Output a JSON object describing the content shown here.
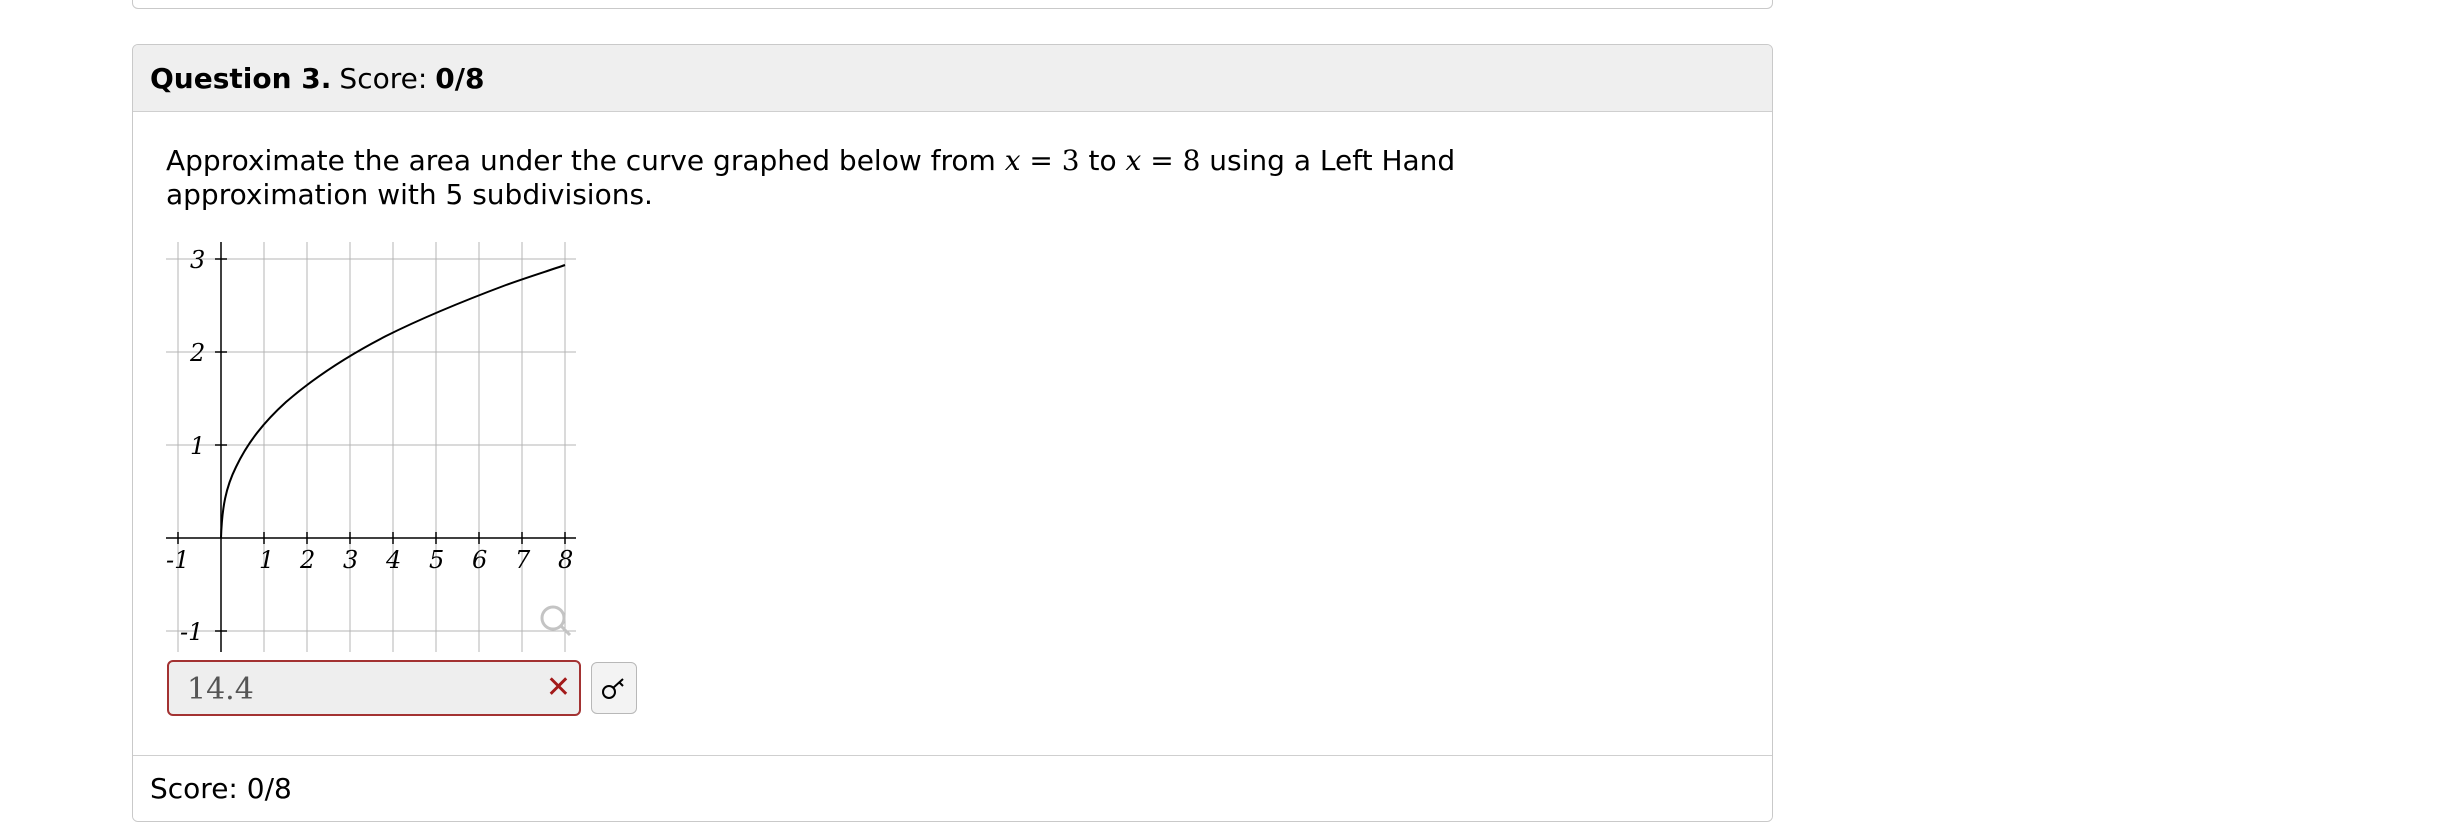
{
  "question": {
    "label": "Question 3.",
    "score_prefix": "Score:",
    "score_value": "0/8"
  },
  "prompt": {
    "part1": "Approximate the area under the curve graphed below from ",
    "x_var": "x",
    "eq": " = ",
    "from_val": "3",
    "to_word": " to ",
    "to_val": "8",
    "part2": " using a Left Hand",
    "line2": "approximation with 5 subdivisions."
  },
  "graph": {
    "x_tick_labels": [
      "-1",
      "1",
      "2",
      "3",
      "4",
      "5",
      "6",
      "7",
      "8"
    ],
    "y_tick_labels": [
      "3",
      "2",
      "1",
      "-1"
    ],
    "curve": "sqrt-like increasing curve from (0,0) to (8,3)",
    "zoom_icon": "magnifier-icon"
  },
  "answer": {
    "value": "14.4",
    "status": "incorrect",
    "status_icon": "x-icon",
    "button_icon": "key-icon"
  },
  "footer": {
    "score_text": "Score: 0/8"
  },
  "colors": {
    "error_border": "#a33232",
    "error_icon": "#a31a1a",
    "header_bg": "#efefef"
  }
}
